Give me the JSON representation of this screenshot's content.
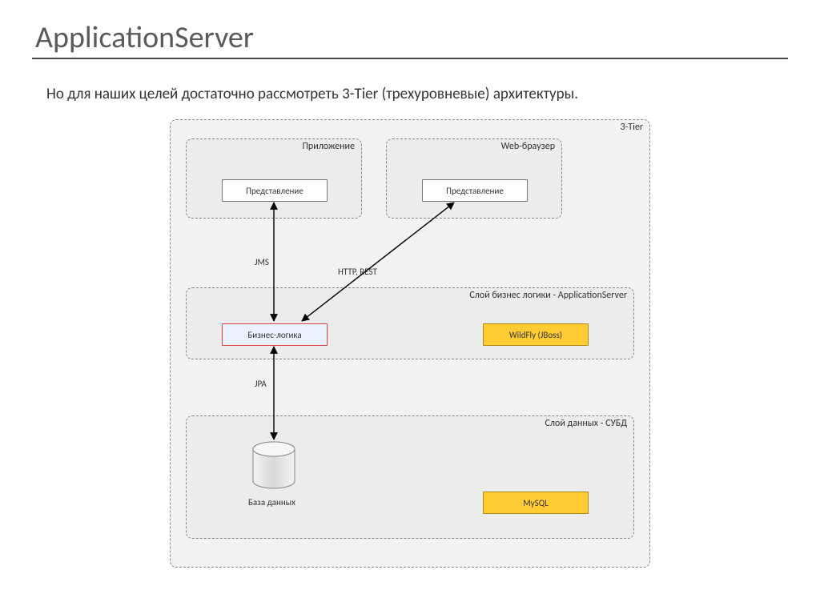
{
  "title": "ApplicationServer",
  "subtitle": "Но для наших целей достаточно рассмотреть 3-Tier (трехуровневые) архитектуры.",
  "frames": {
    "outer": "3-Tier",
    "app": "Приложение",
    "web": "Web-браузер",
    "logic": "Слой бизнес логики - ApplicationServer",
    "data": "Слой данных - СУБД"
  },
  "boxes": {
    "app_view": "Представление",
    "web_view": "Представление",
    "biz_logic": "Бизнес-логика",
    "wildfly": "WildFly (JBoss)",
    "mysql": "MySQL",
    "db_caption": "База данных"
  },
  "edges": {
    "jms": "JMS",
    "http": "HTTP, REST",
    "jpa": "JPA"
  }
}
